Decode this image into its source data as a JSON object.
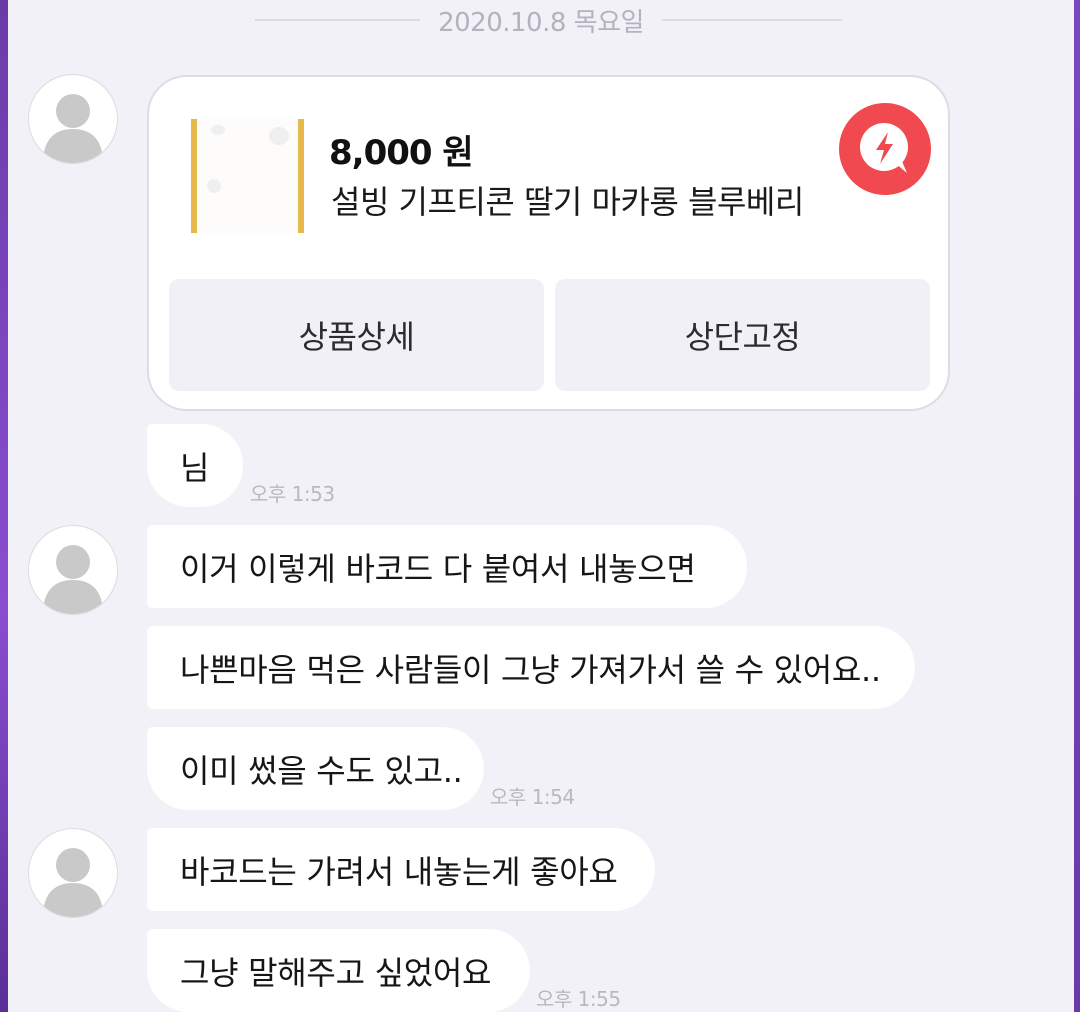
{
  "date_separator": "2020.10.8 목요일",
  "product_card": {
    "price": "8,000 원",
    "name": "설빙 기프티콘 딸기 마카롱 블루베리",
    "buttons": {
      "detail": "상품상세",
      "pin": "상단고정"
    },
    "brand_icon": "lightning-q-icon",
    "brand_color": "#f0494f"
  },
  "messages": [
    {
      "text": "님",
      "time": "오후 1:53"
    },
    {
      "text": "이거 이렇게 바코드 다 붙여서 내놓으면"
    },
    {
      "text": "나쁜마음 먹은 사람들이 그냥 가져가서 쓸 수 있어요.."
    },
    {
      "text": "이미 썼을 수도 있고..",
      "time": "오후 1:54"
    },
    {
      "text": "바코드는 가려서 내놓는게 좋아요"
    },
    {
      "text": "그냥 말해주고 싶었어요",
      "time": "오후 1:55"
    }
  ],
  "colors": {
    "background": "#f2f1f8",
    "bubble": "#ffffff",
    "timestamp": "#b9b8c3",
    "edge": "#7b47c0"
  }
}
